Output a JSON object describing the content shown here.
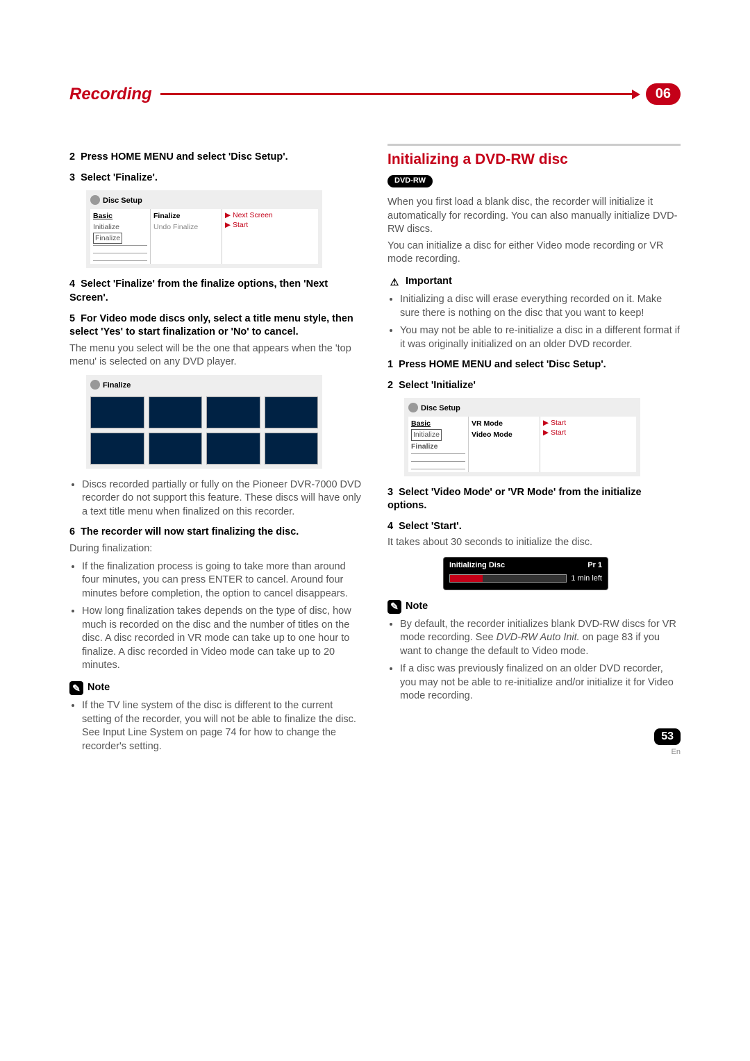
{
  "header": {
    "chapter_title": "Recording",
    "chapter_number": "06"
  },
  "left_col": {
    "step2": "Press HOME MENU and select 'Disc Setup'.",
    "step3": "Select 'Finalize'.",
    "menu1": {
      "header": "Disc Setup",
      "left_basic": "Basic",
      "left_initialize": "Initialize",
      "left_finalize": "Finalize",
      "mid_finalize": "Finalize",
      "mid_undo": "Undo Finalize",
      "right_next": "▶ Next Screen",
      "right_start": "▶ Start"
    },
    "step4": "Select 'Finalize' from the finalize options, then 'Next Screen'.",
    "step5": "For Video mode discs only, select a title menu style, then select 'Yes' to start finalization or 'No' to cancel.",
    "step5_body": "The menu you select will be the one that appears when the 'top menu' is selected on any DVD player.",
    "thumb_header": "Finalize",
    "bullet1": "Discs recorded partially or fully on the Pioneer DVR-7000 DVD recorder do not support this feature. These discs will have only a text title menu when finalized on this recorder.",
    "step6": "The recorder will now start finalizing the disc.",
    "step6_sub": "During finalization:",
    "bullet_fin1": "If the finalization process is going to take more than around four minutes, you can press ENTER to cancel. Around four minutes before completion, the option to cancel disappears.",
    "bullet_fin2": "How long finalization takes depends on the type of disc, how much is recorded on the disc and the number of titles on the disc. A disc recorded in VR mode can take up to one hour to finalize. A disc recorded in Video mode can take up to 20 minutes.",
    "note_head": "Note",
    "note_body": "If the TV line system of the disc is different to the current setting of the recorder, you will not be able to finalize the disc. See Input Line System on page 74 for how to change the recorder's setting."
  },
  "right_col": {
    "title": "Initializing a DVD-RW disc",
    "badge": "DVD-RW",
    "intro1": "When you first load a blank disc, the recorder will initialize it automatically for recording. You can also manually initialize DVD-RW discs.",
    "intro2": "You can initialize a disc for either Video mode recording or VR mode recording.",
    "important_head": "Important",
    "imp_b1": "Initializing a disc will erase everything recorded on it. Make sure there is nothing on the disc that you want to keep!",
    "imp_b2": "You may not be able to re-initialize a disc in a different format if it was originally initialized on an older DVD recorder.",
    "step1": "Press HOME MENU and select 'Disc Setup'.",
    "step2": "Select 'Initialize'",
    "menu2": {
      "header": "Disc Setup",
      "left_basic": "Basic",
      "left_initialize": "Initialize",
      "left_finalize": "Finalize",
      "mid_vr": "VR Mode",
      "mid_video": "Video Mode",
      "right_start1": "▶ Start",
      "right_start2": "▶ Start"
    },
    "step3": "Select 'Video Mode' or 'VR Mode' from the initialize options.",
    "step4": "Select 'Start'.",
    "step4_body": "It takes about 30 seconds to initialize the disc.",
    "progress": {
      "title": "Initializing Disc",
      "pr": "Pr 1",
      "time": "1 min left"
    },
    "note_head": "Note",
    "note_b1_a": "By default, the recorder initializes blank DVD-RW discs for VR mode recording. See ",
    "note_b1_i": "DVD-RW Auto Init.",
    "note_b1_b": " on page 83 if you want to change the default to Video mode.",
    "note_b2": "If a disc was previously finalized on an older DVD recorder, you may not be able to re-initialize and/or initialize it for Video mode recording."
  },
  "footer": {
    "page": "53",
    "lang": "En"
  }
}
